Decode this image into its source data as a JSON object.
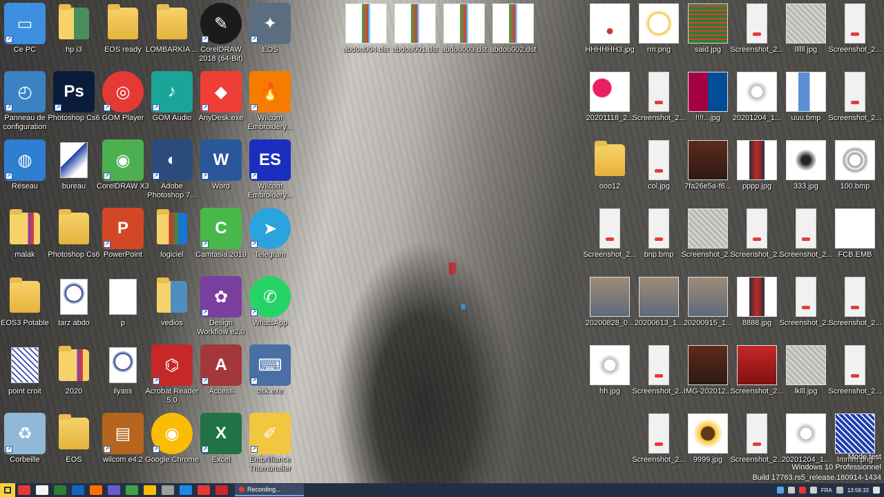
{
  "desktop": {
    "left_icons": [
      {
        "label": "Ce PC",
        "kind": "pc"
      },
      {
        "label": "hp i3",
        "kind": "folder-user"
      },
      {
        "label": "EOS ready",
        "kind": "folder"
      },
      {
        "label": "LOMBARKIA ...",
        "kind": "folder"
      },
      {
        "label": "CorelDRAW 2018 (64-Bit)",
        "kind": "corel"
      },
      {
        "label": "EOS",
        "kind": "eos"
      },
      {
        "label": "Panneau de configuration",
        "kind": "control"
      },
      {
        "label": "Photoshop Cs6",
        "kind": "ps"
      },
      {
        "label": "GOM Player",
        "kind": "gom"
      },
      {
        "label": "GOM Audio",
        "kind": "gomaudio"
      },
      {
        "label": "AnyDesk.exe",
        "kind": "anydesk"
      },
      {
        "label": "Wilcom Embroidery...",
        "kind": "wilcom"
      },
      {
        "label": "Réseau",
        "kind": "network"
      },
      {
        "label": "bureau",
        "kind": "doc-blue"
      },
      {
        "label": "CorelDRAW X3",
        "kind": "corelx3"
      },
      {
        "label": "Adobe Photoshop 7...",
        "kind": "ps7"
      },
      {
        "label": "Word",
        "kind": "word"
      },
      {
        "label": "Wilcom Embroidery...",
        "kind": "es"
      },
      {
        "label": "malak",
        "kind": "folder-pattern"
      },
      {
        "label": "Photoshop Cs6",
        "kind": "folder"
      },
      {
        "label": "PowerPoint",
        "kind": "ppt"
      },
      {
        "label": "logiciel",
        "kind": "folder-color"
      },
      {
        "label": "Camtasia 2019",
        "kind": "camtasia"
      },
      {
        "label": "Telegram",
        "kind": "telegram"
      },
      {
        "label": "EOS3 Potable",
        "kind": "folder"
      },
      {
        "label": "tarz abdo",
        "kind": "doc-face"
      },
      {
        "label": "p",
        "kind": "doc"
      },
      {
        "label": "vedios",
        "kind": "folder-photo"
      },
      {
        "label": "Design Workflow e2.0",
        "kind": "design"
      },
      {
        "label": "WhatsApp",
        "kind": "whatsapp"
      },
      {
        "label": "point croit",
        "kind": "doc-pattern"
      },
      {
        "label": "2020",
        "kind": "folder-pattern"
      },
      {
        "label": "ilyass",
        "kind": "doc-face"
      },
      {
        "label": "Acrobat Reader 5.0",
        "kind": "acrobat"
      },
      {
        "label": "Access",
        "kind": "access"
      },
      {
        "label": "osk.exe",
        "kind": "osk"
      },
      {
        "label": "Corbeille",
        "kind": "bin"
      },
      {
        "label": "EOS",
        "kind": "folder"
      },
      {
        "label": "wilcom e4.2",
        "kind": "winrar"
      },
      {
        "label": "Google Chrome",
        "kind": "chrome"
      },
      {
        "label": "Excel",
        "kind": "excel"
      },
      {
        "label": "Embrilliance Thumbnailer",
        "kind": "embr"
      }
    ],
    "top_files": [
      {
        "label": "abdou004.dst",
        "kind": "dst"
      },
      {
        "label": "abdou001.dst",
        "kind": "dst"
      },
      {
        "label": "abdou003.dst",
        "kind": "dst"
      },
      {
        "label": "abdou002.dst",
        "kind": "dst"
      }
    ],
    "right_icons": [
      {
        "label": "HHHHHH3.jpg",
        "kind": "face"
      },
      {
        "label": "rm.png",
        "kind": "crest"
      },
      {
        "label": "said.jpg",
        "kind": "green"
      },
      {
        "label": "Screenshot_2...",
        "kind": "phone"
      },
      {
        "label": "llllll.jpg",
        "kind": "embroid"
      },
      {
        "label": "Screenshot_2...",
        "kind": "phone"
      },
      {
        "label": "20201118_2...",
        "kind": "face-pink"
      },
      {
        "label": "Screenshot_2...",
        "kind": "phone"
      },
      {
        "label": "!!!!...jpg",
        "kind": "barca"
      },
      {
        "label": "20201204_1...",
        "kind": "flower"
      },
      {
        "label": "uuu.bmp",
        "kind": "blue-strip"
      },
      {
        "label": "Screenshot_2...",
        "kind": "phone"
      },
      {
        "label": "ooo12",
        "kind": "folder"
      },
      {
        "label": "col.jpg",
        "kind": "phone"
      },
      {
        "label": "7fa26e5a-f6...",
        "kind": "dress"
      },
      {
        "label": "pppp.jpg",
        "kind": "strip-dark"
      },
      {
        "label": "333.jpg",
        "kind": "flame"
      },
      {
        "label": "100.bmp",
        "kind": "mandala"
      },
      {
        "label": "Screenshot_2...",
        "kind": "phone"
      },
      {
        "label": "bnp.bmp",
        "kind": "phone"
      },
      {
        "label": "Screenshot_2...",
        "kind": "embroid"
      },
      {
        "label": "Screenshot_2...",
        "kind": "phone"
      },
      {
        "label": "Screenshot_2...",
        "kind": "phone"
      },
      {
        "label": "FCB.EMB",
        "kind": "blank"
      },
      {
        "label": "20200828_0...",
        "kind": "person"
      },
      {
        "label": "20200613_1...",
        "kind": "person"
      },
      {
        "label": "20200915_1...",
        "kind": "person"
      },
      {
        "label": "8888.jpg",
        "kind": "strip-dark"
      },
      {
        "label": "Screenshot_2...",
        "kind": "phone"
      },
      {
        "label": "Screenshot_2...",
        "kind": "phone"
      },
      {
        "label": "hh.jpg",
        "kind": "flower"
      },
      {
        "label": "Screenshot_2...",
        "kind": "phone"
      },
      {
        "label": "IMG-202012...",
        "kind": "dress"
      },
      {
        "label": "Screenshot_2...",
        "kind": "red"
      },
      {
        "label": "lklll.jpg",
        "kind": "embroid"
      },
      {
        "label": "Screenshot_2...",
        "kind": "phone"
      },
      {
        "label": "",
        "kind": "none"
      },
      {
        "label": "Screenshot_2...",
        "kind": "phone"
      },
      {
        "label": "9999.jpg",
        "kind": "sunflower"
      },
      {
        "label": "Screenshot_2...",
        "kind": "phone"
      },
      {
        "label": "20201204_1...",
        "kind": "flower"
      },
      {
        "label": "Immm.png",
        "kind": "blue-pattern"
      }
    ],
    "watermark": {
      "line1": "Mode test",
      "line2": "Windows 10 Professionnel",
      "line3": "Build 17763.rs5_release.180914-1434"
    }
  },
  "taskbar": {
    "recording_label": "Recording...",
    "language": "FRA",
    "time": "13:58:33",
    "colors": [
      "#e53935",
      "#f5f5f5",
      "#2e7d32",
      "#1565c0",
      "#ff6f00",
      "#6a5acd",
      "#43a047",
      "#fbbc05",
      "#9e9e9e",
      "#1e88e5",
      "#e53935",
      "#c62828"
    ]
  }
}
